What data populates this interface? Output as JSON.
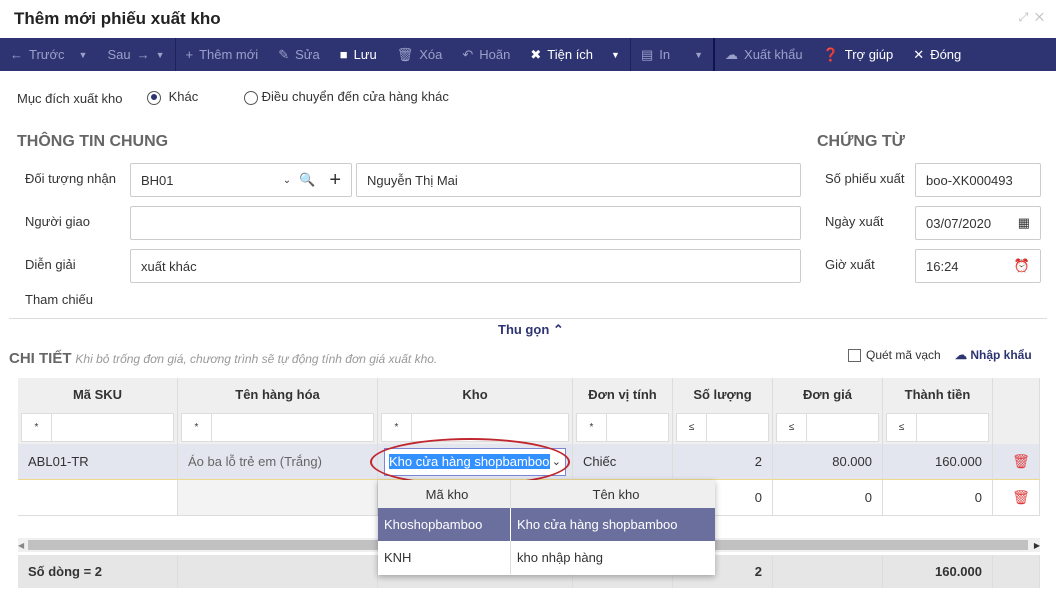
{
  "title": "Thêm mới phiếu xuất kho",
  "toolbar": {
    "prev": "Trước",
    "next": "Sau",
    "add": "Thêm mới",
    "edit": "Sửa",
    "save": "Lưu",
    "delete": "Xóa",
    "undo": "Hoãn",
    "utility": "Tiện ích",
    "print": "In",
    "export": "Xuất khẩu",
    "help": "Trợ giúp",
    "close": "Đóng"
  },
  "purpose": {
    "label": "Mục đích xuất kho",
    "opt1": "Khác",
    "opt2": "Điều chuyển đến cửa hàng khác",
    "selected": "Khác"
  },
  "general": {
    "heading": "THÔNG TIN CHUNG",
    "recipient_label": "Đối tượng nhận",
    "recipient_code": "BH01",
    "recipient_name": "Nguyễn Thị Mai",
    "deliverer_label": "Người giao",
    "deliverer": "",
    "desc_label": "Diễn giải",
    "desc": "xuất khác",
    "ref_label": "Tham chiếu"
  },
  "voucher": {
    "heading": "CHỨNG TỪ",
    "no_label": "Số phiếu xuất",
    "no": "boo-XK000493",
    "date_label": "Ngày xuất",
    "date": "03/07/2020",
    "time_label": "Giờ xuất",
    "time": "16:24"
  },
  "collapse": "Thu gọn",
  "detail": {
    "heading": "CHI TIẾT",
    "hint": "Khi bỏ trống đơn giá, chương trình sẽ tự động tính đơn giá xuất kho.",
    "scan": "Quét mã vạch",
    "import": "Nhập khẩu"
  },
  "table": {
    "headers": [
      "Mã SKU",
      "Tên hàng hóa",
      "Kho",
      "Đơn vị tính",
      "Số lượng",
      "Đơn giá",
      "Thành tiền"
    ],
    "filter_ops": [
      "*",
      "*",
      "*",
      "*",
      "≤",
      "≤",
      "≤"
    ],
    "rows": [
      [
        "ABL01-TR",
        "Áo ba lỗ trẻ em (Trắng)",
        "Kho cửa hàng shopbamboo",
        "Chiếc",
        "2",
        "80.000",
        "160.000"
      ],
      [
        "",
        "",
        "",
        "",
        "0",
        "0",
        "0"
      ]
    ],
    "footer": {
      "count": "Số dòng = 2",
      "qty": "2",
      "total": "160.000"
    }
  },
  "dropdown": {
    "headers": [
      "Mã kho",
      "Tên kho"
    ],
    "rows": [
      [
        "Khoshopbamboo",
        "Kho cửa hàng shopbamboo"
      ],
      [
        "KNH",
        "kho nhập hàng"
      ]
    ]
  }
}
